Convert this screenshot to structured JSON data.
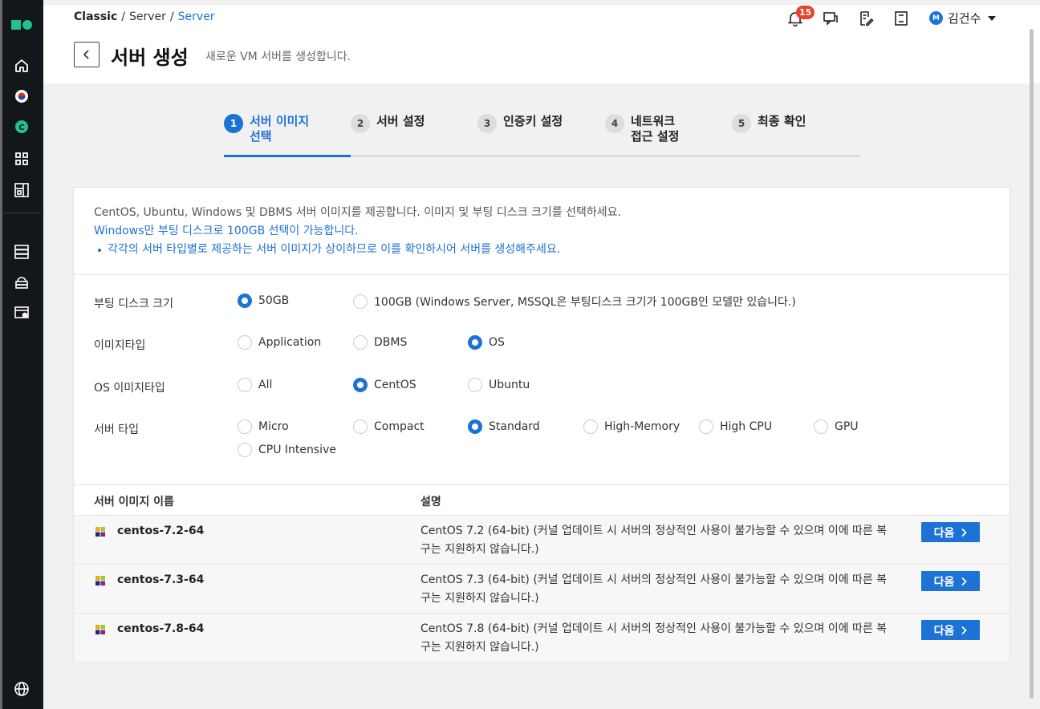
{
  "breadcrumb": [
    "Classic",
    "Server",
    "Server"
  ],
  "page": {
    "title": "서버 생성",
    "subtitle": "새로운 VM 서버를 생성합니다."
  },
  "header": {
    "notification_count": "15",
    "user_initial": "M",
    "user_name": "김건수"
  },
  "steps": [
    {
      "num": "1",
      "label": "서버 이미지 선택",
      "active": true
    },
    {
      "num": "2",
      "label": "서버 설정"
    },
    {
      "num": "3",
      "label": "인증키 설정"
    },
    {
      "num": "4",
      "label": "네트워크 접근 설정"
    },
    {
      "num": "5",
      "label": "최종 확인"
    }
  ],
  "info": {
    "line1": "CentOS, Ubuntu, Windows 및 DBMS 서버 이미지를 제공합니다. 이미지 및 부팅 디스크 크기를 선택하세요.",
    "line2": "Windows만 부팅 디스크로 100GB 선택이 가능합니다.",
    "line3": "각각의 서버 타입별로 제공하는 서버 이미지가 상이하므로 이를 확인하시어 서버를 생성해주세요."
  },
  "filters": {
    "boot_disk": {
      "label": "부팅 디스크 크기",
      "options": [
        "50GB",
        "100GB (Windows Server, MSSQL은 부팅디스크 크기가 100GB인 모델만 있습니다.)"
      ],
      "selected": 0
    },
    "image_type": {
      "label": "이미지타입",
      "options": [
        "Application",
        "DBMS",
        "OS"
      ],
      "selected": 2
    },
    "os_image_type": {
      "label": "OS 이미지타입",
      "options": [
        "All",
        "CentOS",
        "Ubuntu"
      ],
      "selected": 1
    },
    "server_type": {
      "label": "서버 타입",
      "options": [
        "Micro",
        "Compact",
        "Standard",
        "High-Memory",
        "High CPU",
        "GPU",
        "CPU Intensive"
      ],
      "selected": 2
    }
  },
  "table": {
    "headers": [
      "서버 이미지 이름",
      "설명"
    ],
    "next_label": "다음",
    "rows": [
      {
        "name": "centos-7.2-64",
        "desc": "CentOS 7.2 (64-bit) (커널 업데이트 시 서버의 정상적인 사용이 불가능할 수 있으며 이에 따른 복구는 지원하지 않습니다.)"
      },
      {
        "name": "centos-7.3-64",
        "desc": "CentOS 7.3 (64-bit) (커널 업데이트 시 서버의 정상적인 사용이 불가능할 수 있으며 이에 따른 복구는 지원하지 않습니다.)"
      },
      {
        "name": "centos-7.8-64",
        "desc": "CentOS 7.8 (64-bit) (커널 업데이트 시 서버의 정상적인 사용이 불가능할 수 있으며 이에 따른 복구는 지원하지 않습니다.)"
      }
    ]
  },
  "colors": {
    "accent": "#1d72d6",
    "sidebar": "#13161a",
    "badge": "#e8432e",
    "logo": "#21c090"
  }
}
